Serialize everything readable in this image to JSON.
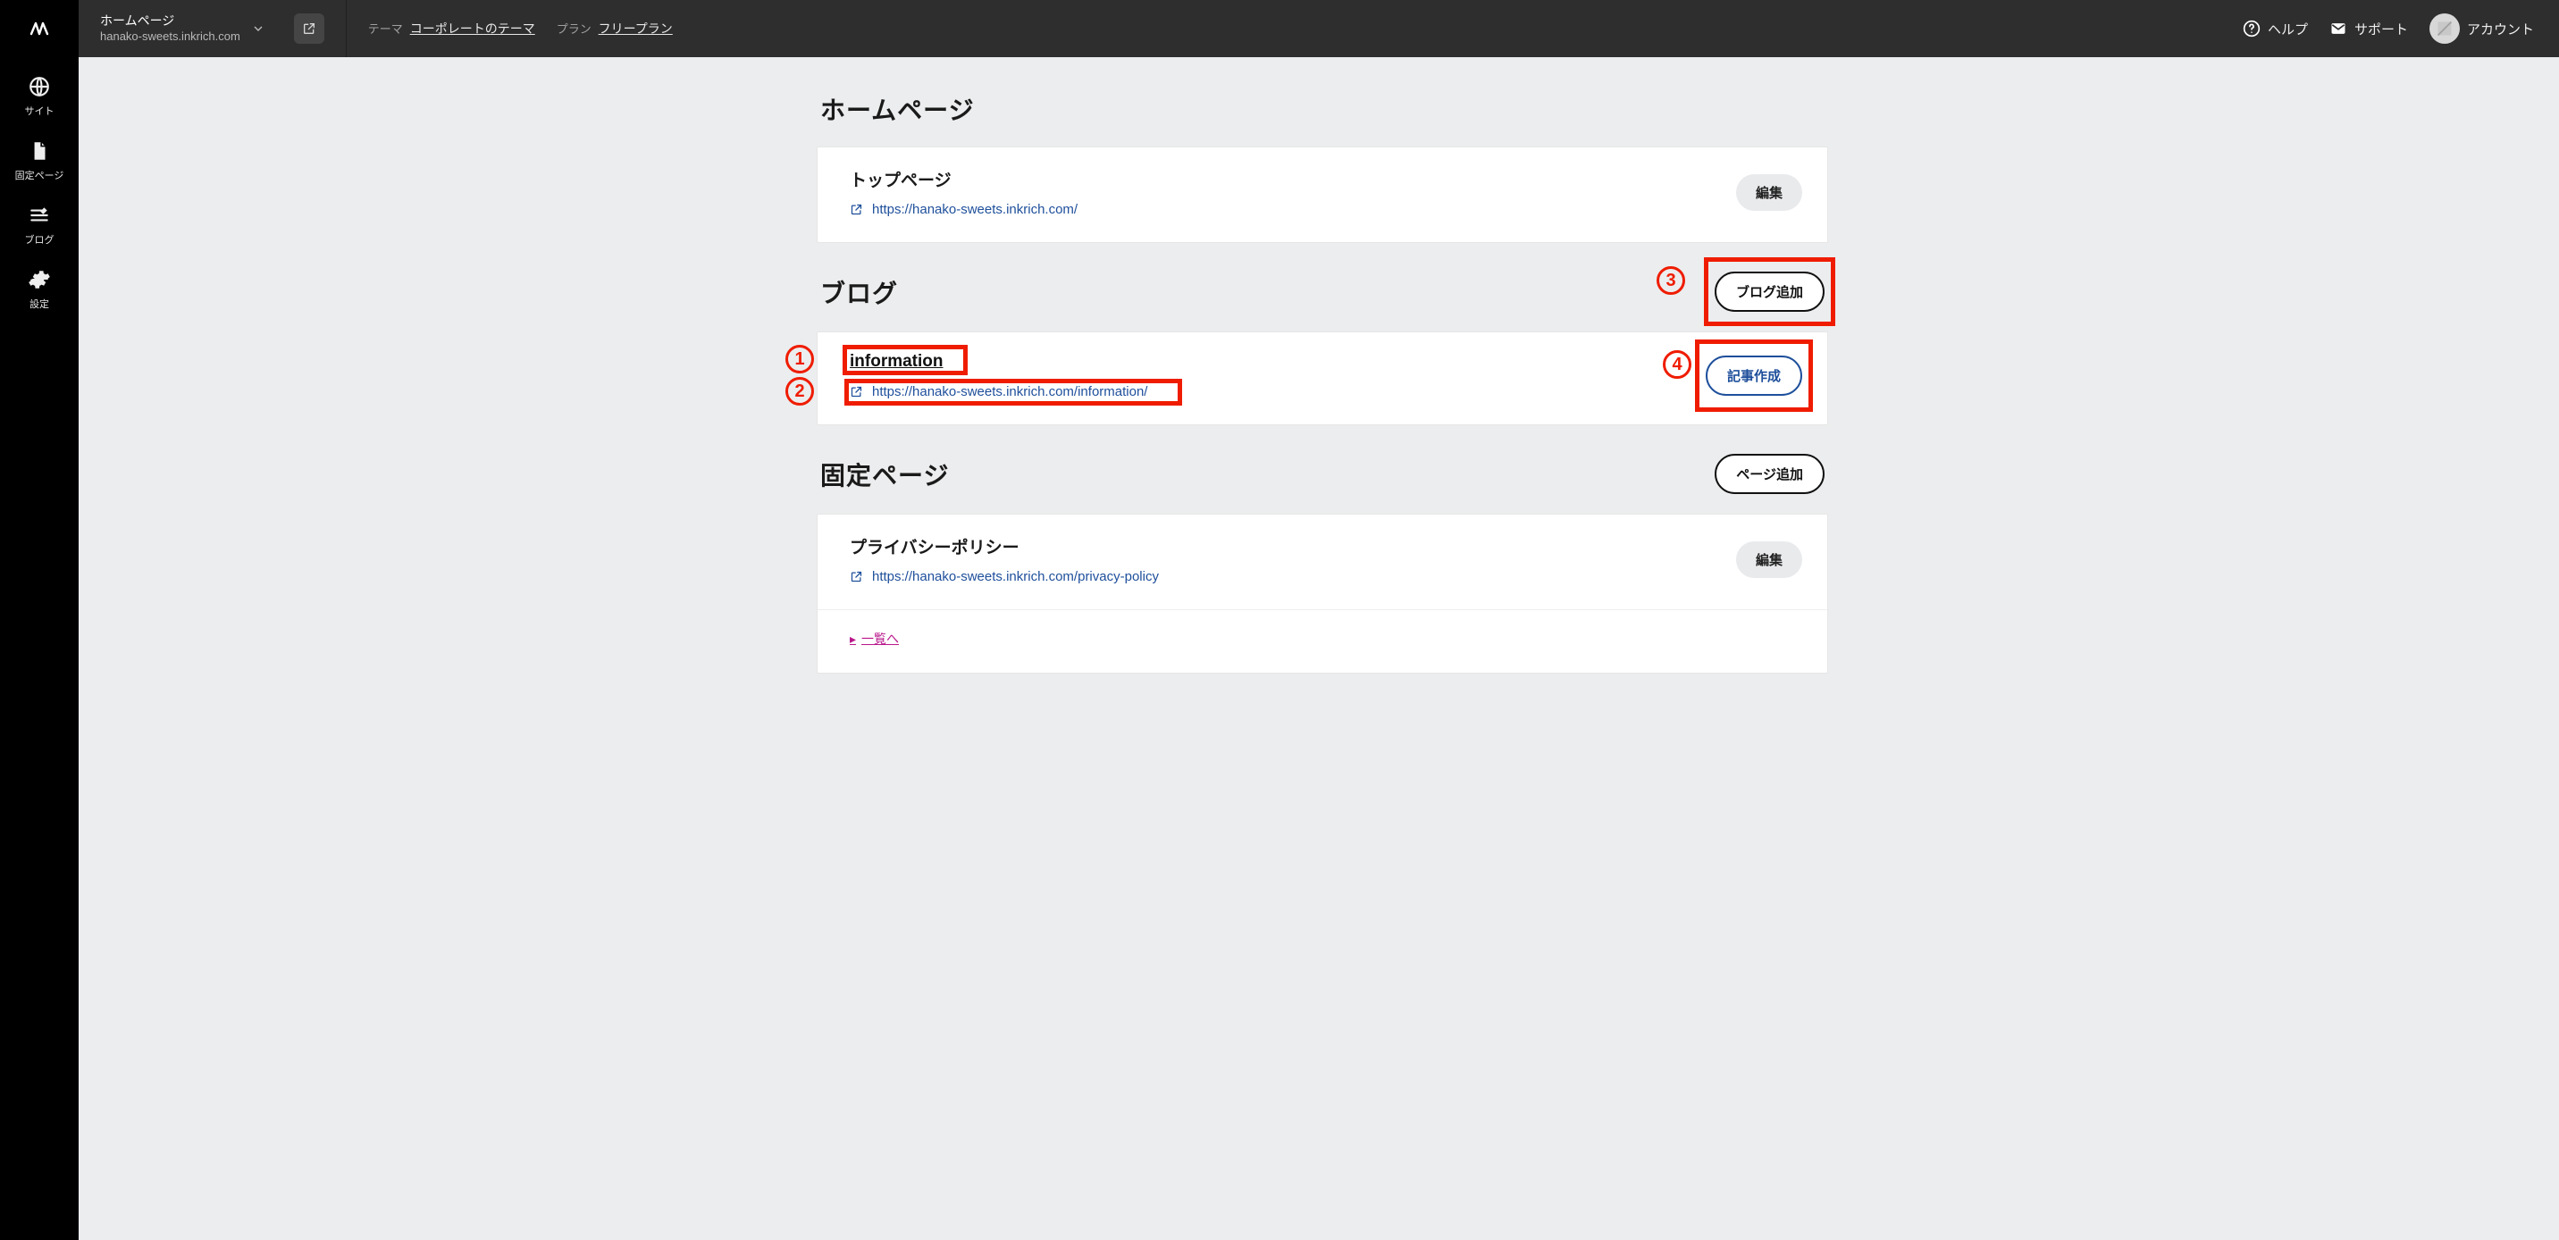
{
  "topbar": {
    "site_title": "ホームページ",
    "site_domain": "hanako-sweets.inkrich.com",
    "theme_label": "テーマ",
    "theme_value": "コーポレートのテーマ",
    "plan_label": "プラン",
    "plan_value": "フリープラン",
    "help": "ヘルプ",
    "support": "サポート",
    "account": "アカウント"
  },
  "sidebar": {
    "items": [
      {
        "label": "サイト"
      },
      {
        "label": "固定ページ"
      },
      {
        "label": "ブログ"
      },
      {
        "label": "設定"
      }
    ]
  },
  "sections": {
    "homepage": {
      "heading": "ホームページ",
      "top_title": "トップページ",
      "top_url": "https://hanako-sweets.inkrich.com/",
      "edit_label": "編集"
    },
    "blog": {
      "heading": "ブログ",
      "add_blog_label": "ブログ追加",
      "info_title": "information",
      "info_url": "https://hanako-sweets.inkrich.com/information/",
      "create_post_label": "記事作成"
    },
    "fixed": {
      "heading": "固定ページ",
      "add_page_label": "ページ追加",
      "privacy_title": "プライバシーポリシー",
      "privacy_url": "https://hanako-sweets.inkrich.com/privacy-policy",
      "edit_label": "編集",
      "list_link": "一覧へ"
    }
  },
  "annotations": {
    "n1": "1",
    "n2": "2",
    "n3": "3",
    "n4": "4"
  }
}
